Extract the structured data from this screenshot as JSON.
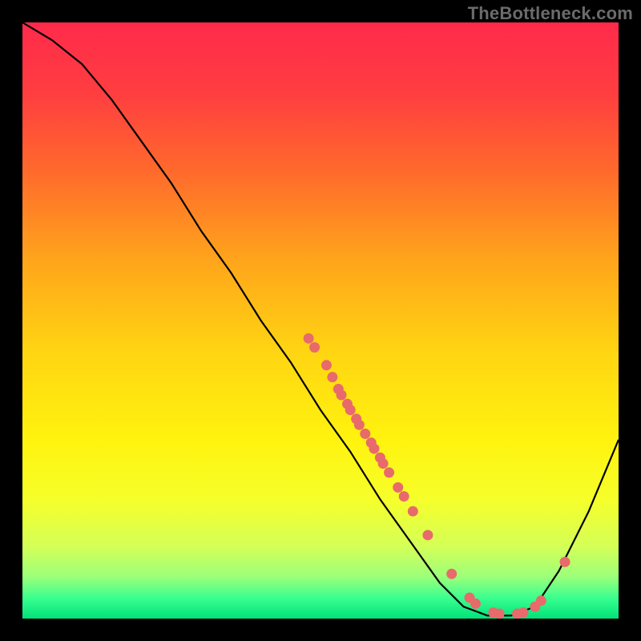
{
  "watermark": "TheBottleneck.com",
  "chart_data": {
    "type": "line",
    "title": "",
    "xlabel": "",
    "ylabel": "",
    "xlim": [
      0,
      100
    ],
    "ylim": [
      0,
      100
    ],
    "grid": false,
    "legend": false,
    "background_gradient": {
      "stops": [
        {
          "pos": 0.0,
          "color": "#ff2a4b"
        },
        {
          "pos": 0.12,
          "color": "#ff3e40"
        },
        {
          "pos": 0.25,
          "color": "#ff6a2c"
        },
        {
          "pos": 0.4,
          "color": "#ffa51b"
        },
        {
          "pos": 0.55,
          "color": "#ffd412"
        },
        {
          "pos": 0.7,
          "color": "#fff30e"
        },
        {
          "pos": 0.8,
          "color": "#f6ff2a"
        },
        {
          "pos": 0.88,
          "color": "#d4ff57"
        },
        {
          "pos": 0.93,
          "color": "#9cff7a"
        },
        {
          "pos": 0.965,
          "color": "#3bff8e"
        },
        {
          "pos": 1.0,
          "color": "#00e27a"
        }
      ]
    },
    "curve": [
      {
        "x": 0,
        "y": 100
      },
      {
        "x": 5,
        "y": 97
      },
      {
        "x": 10,
        "y": 93
      },
      {
        "x": 15,
        "y": 87
      },
      {
        "x": 20,
        "y": 80
      },
      {
        "x": 25,
        "y": 73
      },
      {
        "x": 30,
        "y": 65
      },
      {
        "x": 35,
        "y": 58
      },
      {
        "x": 40,
        "y": 50
      },
      {
        "x": 45,
        "y": 43
      },
      {
        "x": 50,
        "y": 35
      },
      {
        "x": 55,
        "y": 28
      },
      {
        "x": 60,
        "y": 20
      },
      {
        "x": 65,
        "y": 13
      },
      {
        "x": 70,
        "y": 6
      },
      {
        "x": 74,
        "y": 2
      },
      {
        "x": 78,
        "y": 0.5
      },
      {
        "x": 82,
        "y": 0.5
      },
      {
        "x": 86,
        "y": 2
      },
      {
        "x": 90,
        "y": 8
      },
      {
        "x": 95,
        "y": 18
      },
      {
        "x": 100,
        "y": 30
      }
    ],
    "points": [
      {
        "x": 48,
        "y": 47
      },
      {
        "x": 49,
        "y": 45.5
      },
      {
        "x": 51,
        "y": 42.5
      },
      {
        "x": 52,
        "y": 40.5
      },
      {
        "x": 53,
        "y": 38.5
      },
      {
        "x": 53.5,
        "y": 37.5
      },
      {
        "x": 54.5,
        "y": 36
      },
      {
        "x": 55,
        "y": 35
      },
      {
        "x": 56,
        "y": 33.5
      },
      {
        "x": 56.5,
        "y": 32.5
      },
      {
        "x": 57.5,
        "y": 31
      },
      {
        "x": 58.5,
        "y": 29.5
      },
      {
        "x": 59,
        "y": 28.5
      },
      {
        "x": 60,
        "y": 27
      },
      {
        "x": 60.5,
        "y": 26
      },
      {
        "x": 61.5,
        "y": 24.5
      },
      {
        "x": 63,
        "y": 22
      },
      {
        "x": 64,
        "y": 20.5
      },
      {
        "x": 65.5,
        "y": 18
      },
      {
        "x": 68,
        "y": 14
      },
      {
        "x": 72,
        "y": 7.5
      },
      {
        "x": 75,
        "y": 3.5
      },
      {
        "x": 76,
        "y": 2.5
      },
      {
        "x": 79,
        "y": 1
      },
      {
        "x": 80,
        "y": 0.8
      },
      {
        "x": 83,
        "y": 0.8
      },
      {
        "x": 84,
        "y": 1
      },
      {
        "x": 86,
        "y": 2
      },
      {
        "x": 87,
        "y": 3
      },
      {
        "x": 91,
        "y": 9.5
      }
    ],
    "point_color": "#e86a6a",
    "curve_color": "#000000"
  }
}
